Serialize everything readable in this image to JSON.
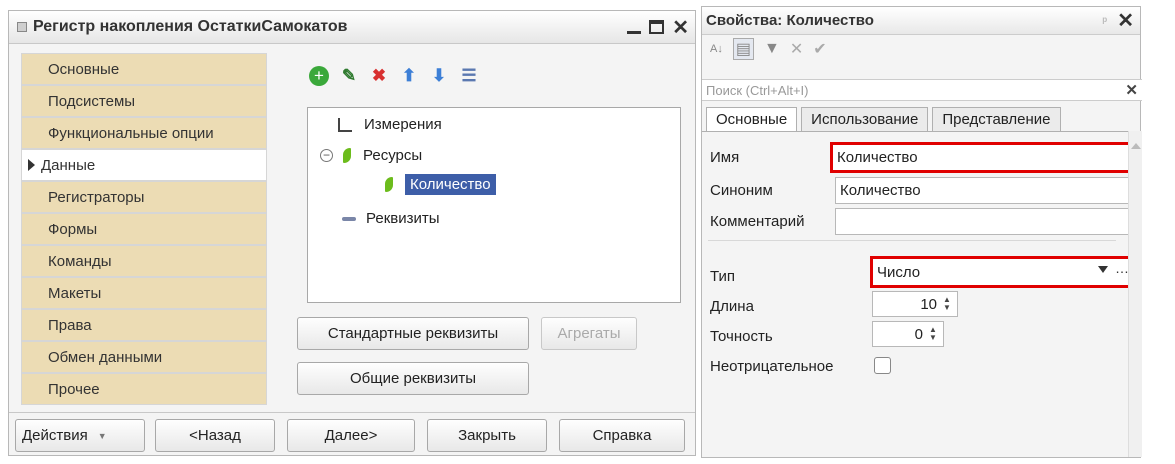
{
  "left_window": {
    "title": "Регистр накопления ОстаткиСамокатов",
    "nav": [
      "Основные",
      "Подсистемы",
      "Функциональные опции",
      "Данные",
      "Регистраторы",
      "Формы",
      "Команды",
      "Макеты",
      "Права",
      "Обмен данными",
      "Прочее"
    ],
    "active_nav": "Данные",
    "tree": {
      "dimensions": "Измерения",
      "resources": "Ресурсы",
      "selected_resource": "Количество",
      "attributes": "Реквизиты"
    },
    "buttons": {
      "standard_attrs": "Стандартные реквизиты",
      "aggregates": "Агрегаты",
      "common_attrs": "Общие реквизиты"
    },
    "bottom": {
      "actions": "Действия",
      "back": "<Назад",
      "next": "Далее>",
      "close": "Закрыть",
      "help": "Справка"
    }
  },
  "right_window": {
    "title": "Свойства: Количество",
    "search_placeholder": "Поиск (Ctrl+Alt+I)",
    "tabs": [
      "Основные",
      "Использование",
      "Представление"
    ],
    "fields": {
      "name_label": "Имя",
      "name_value": "Количество",
      "synonym_label": "Синоним",
      "synonym_value": "Количество",
      "comment_label": "Комментарий",
      "comment_value": "",
      "type_label": "Тип",
      "type_value": "Число",
      "length_label": "Длина",
      "length_value": "10",
      "precision_label": "Точность",
      "precision_value": "0",
      "nonneg_label": "Неотрицательное"
    },
    "highlight_color": "#e00000"
  }
}
